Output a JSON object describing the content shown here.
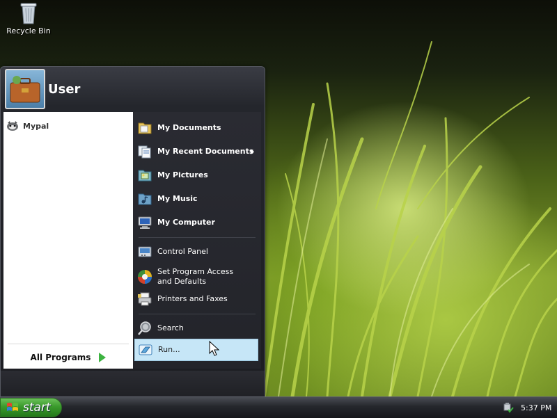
{
  "desktop": {
    "icons": [
      {
        "label": "Recycle Bin",
        "icon": "recycle-bin-icon"
      }
    ]
  },
  "start_menu": {
    "user_name": "User",
    "pinned": [
      {
        "label": "Mypal",
        "icon": "mypal-icon"
      }
    ],
    "all_programs_label": "All Programs",
    "places": [
      {
        "label": "My Documents",
        "icon": "folder-icon",
        "bold": true
      },
      {
        "label": "My Recent Documents",
        "icon": "recent-documents-icon",
        "bold": true,
        "submenu": true
      },
      {
        "label": "My Pictures",
        "icon": "pictures-icon",
        "bold": true
      },
      {
        "label": "My Music",
        "icon": "music-icon",
        "bold": true
      },
      {
        "label": "My Computer",
        "icon": "computer-icon",
        "bold": true
      }
    ],
    "settings": [
      {
        "label": "Control Panel",
        "icon": "control-panel-icon"
      },
      {
        "label": "Set Program Access and Defaults",
        "icon": "program-defaults-icon"
      },
      {
        "label": "Printers and Faxes",
        "icon": "printer-icon"
      }
    ],
    "tools": [
      {
        "label": "Search",
        "icon": "search-icon"
      },
      {
        "label": "Run...",
        "icon": "run-icon",
        "highlighted": true
      }
    ]
  },
  "taskbar": {
    "start_label": "start",
    "clock": "5:37 PM",
    "tray_icons": [
      "safely-remove-hardware-icon"
    ]
  },
  "colors": {
    "menu_dark": "#1c1d22",
    "hover_highlight": "#c6e6f7",
    "start_green": "#3a9a2c",
    "all_programs_arrow": "#3db341"
  }
}
